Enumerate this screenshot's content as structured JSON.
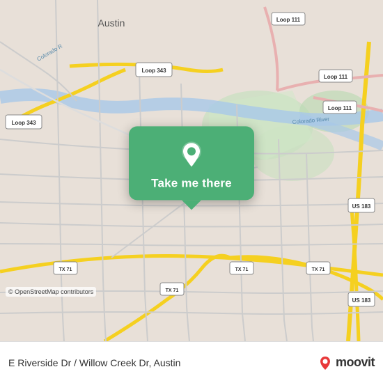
{
  "map": {
    "background_color": "#e8e0d8",
    "attribution": "© OpenStreetMap contributors"
  },
  "popup": {
    "button_label": "Take me there",
    "background_color": "#4caf76",
    "pin_icon": "location-pin-icon"
  },
  "bottom_bar": {
    "location_text": "E Riverside Dr / Willow Creek Dr, Austin",
    "logo_text": "moovit"
  }
}
